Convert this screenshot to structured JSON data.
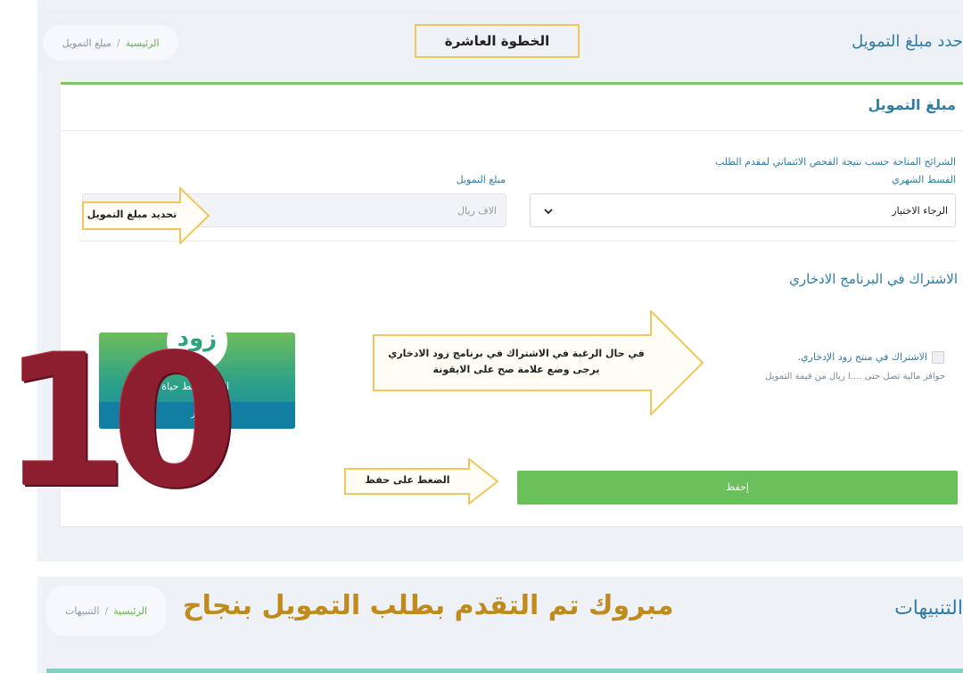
{
  "header": {
    "page_title": "حدد مبلغ التمويل",
    "step_label": "الخطوة العاشرة",
    "breadcrumb": {
      "home": "الرئيسية",
      "separator": "/",
      "current": "مبلغ التمويل"
    }
  },
  "card": {
    "title": "مبلغ التمويل",
    "tiers_label": "الشرائح المتاحة حسب نتيجة الفحص الائتماني لمقدم الطلب",
    "installment_label": "القسط الشهري",
    "installment_select": {
      "value": "الرجاء الاختيار"
    },
    "amount_label": "مبلغ التمويل",
    "amount_input": {
      "placeholder": "الاف ريال"
    },
    "savings_title": "الاشتراك في البرنامج الادخاري",
    "savings_checkbox": {
      "label": "الاشتراك في منتج زود الإدخاري.",
      "sub": "حوافز مالية تصل حتى ....ا ريال من قيمة التمويل",
      "checked": false
    },
    "promo": {
      "logo": "زود",
      "text": "الادخار نمط حياة",
      "link": "تعرف أكثر"
    },
    "save_button": "إحفظ"
  },
  "annotations": {
    "amount_arrow": "تحديد مبلغ التمويل",
    "savings_arrow_line1": "في حال الرغبة في الاشتراك في برنامج زود الادخاري",
    "savings_arrow_line2": "يرجى وضع علامة صح على الايقونة",
    "save_arrow": "الضغط على حفظ",
    "step_number": "10",
    "congrats": "مبروك تم التقدم بطلب التمويل بنجاح"
  },
  "notifications": {
    "title": "التنبيهات",
    "breadcrumb": {
      "home": "الرئيسية",
      "separator": "/",
      "current": "التنبيهات"
    }
  },
  "colors": {
    "primary": "#2f7da5",
    "accent_green": "#6cc05c",
    "annotation_border": "#f0c75e",
    "step_number": "#8c1e2f",
    "congrats": "#c08a1c"
  }
}
